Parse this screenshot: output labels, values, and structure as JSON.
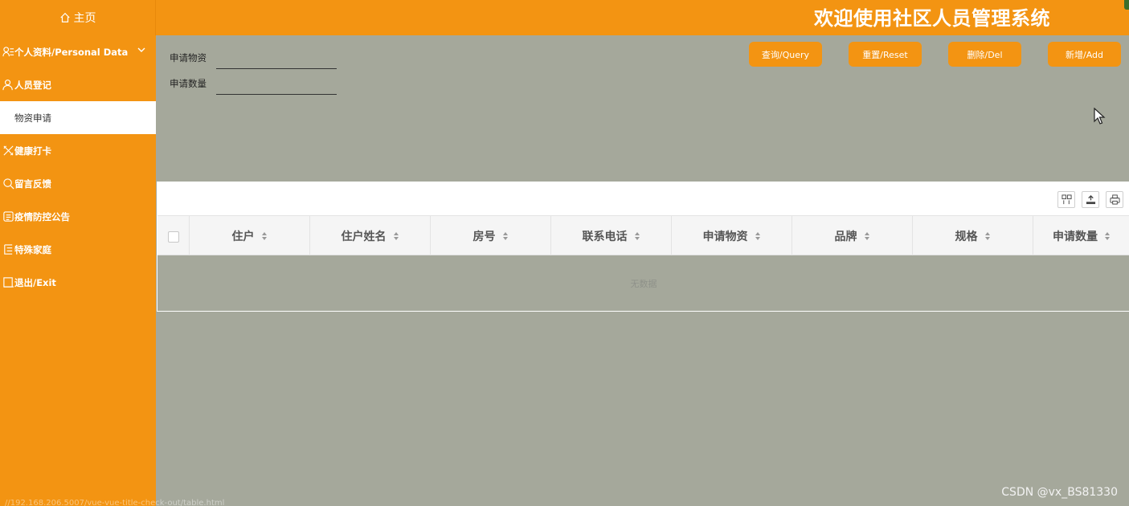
{
  "header": {
    "home_label": "主页",
    "title": "欢迎使用社区人员管理系统"
  },
  "sidebar": {
    "items": [
      {
        "label": "个人资料/Personal Data",
        "icon": "profile-icon"
      },
      {
        "label": "人员登记",
        "icon": "user-icon"
      },
      {
        "label": "物资申请",
        "icon": ""
      },
      {
        "label": "健康打卡",
        "icon": "health-icon"
      },
      {
        "label": "留言反馈",
        "icon": "feedback-icon"
      },
      {
        "label": "疫情防控公告",
        "icon": "notice-icon"
      },
      {
        "label": "特殊家庭",
        "icon": "family-icon"
      },
      {
        "label": "退出/Exit",
        "icon": "exit-icon"
      }
    ],
    "active": "物资申请",
    "url": "//192.168.206.5007/vue-vue-title-check-out/table.html"
  },
  "search": {
    "fields": [
      {
        "label": "申请物资",
        "value": ""
      },
      {
        "label": "申请数量",
        "value": ""
      }
    ],
    "buttons": {
      "query": "查询/Query",
      "reset": "重置/Reset",
      "delete": "删除/Del",
      "add": "新增/Add"
    }
  },
  "table": {
    "columns": [
      "住户",
      "住户姓名",
      "房号",
      "联系电话",
      "申请物资",
      "品牌",
      "规格",
      "申请数量"
    ],
    "empty_text": "无数据",
    "toolbar_icons": [
      "columns-icon",
      "export-icon",
      "print-icon"
    ]
  },
  "watermark": "CSDN @vx_BS81330",
  "colors": {
    "accent": "#f39412",
    "content_bg": "#a5a89b",
    "header_text": "#ffffff"
  }
}
